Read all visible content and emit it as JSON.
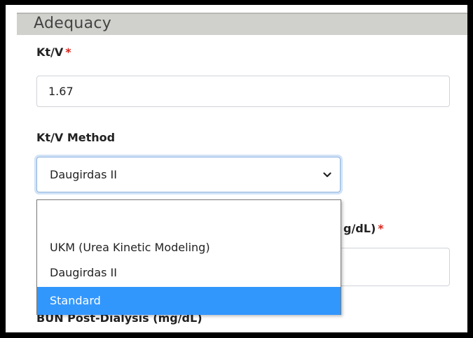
{
  "section": {
    "title": "Adequacy"
  },
  "ktv": {
    "label": "Kt/V",
    "required_mark": "*",
    "value": "1.67"
  },
  "ktv_method": {
    "label": "Kt/V Method",
    "selected": "Daugirdas II",
    "options": [
      {
        "label": ""
      },
      {
        "label": "UKM (Urea Kinetic Modeling)"
      },
      {
        "label": "Daugirdas II"
      },
      {
        "label": "Standard"
      }
    ]
  },
  "bun_pre": {
    "label_fragment": "g/dL)",
    "required_mark": "*"
  },
  "bun_post": {
    "label": "BUN Post-Dialysis (mg/dL)"
  },
  "colors": {
    "accent": "#3297fd",
    "required": "#d9251c",
    "header_bg": "#d0d0cc"
  },
  "icons": {
    "select_chevron": "chevron-down-icon"
  }
}
